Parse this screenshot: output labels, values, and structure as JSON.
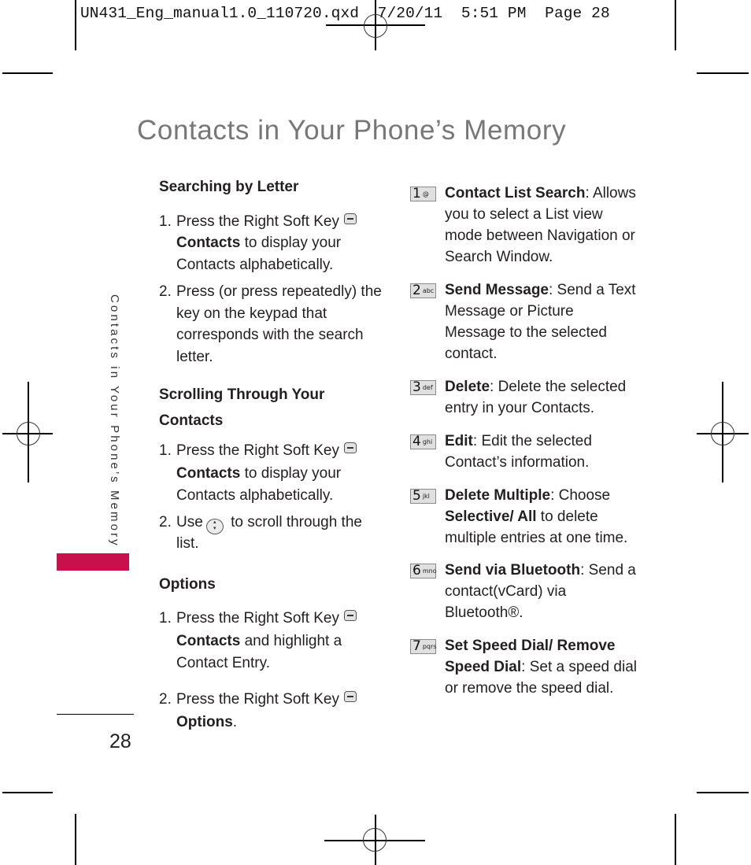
{
  "slug": {
    "filename": "UN431_Eng_manual1.0_110720.qxd",
    "date": "7/20/11",
    "time": "5:51 PM",
    "page_label": "Page 28"
  },
  "title": "Contacts in Your Phone’s Memory",
  "side_tab": {
    "text": "Contacts in Your Phone’s Memory",
    "accent_color": "#c8104c"
  },
  "page_number": "28",
  "left_column": {
    "sections": [
      {
        "heading": "Searching by Letter",
        "steps": [
          {
            "num": "1.",
            "pre": "Press the Right Soft Key",
            "icon": "right-soft-key-icon",
            "bold": "Contacts",
            "post": " to display your Contacts alphabetically."
          },
          {
            "num": "2.",
            "text": "Press (or press repeatedly) the key on the keypad that corresponds with the search letter."
          }
        ]
      },
      {
        "heading": "Scrolling Through Your Contacts",
        "steps": [
          {
            "num": "1.",
            "pre": "Press the Right Soft Key",
            "icon": "right-soft-key-icon",
            "bold": "Contacts",
            "post": " to display your Contacts alphabetically."
          },
          {
            "num": "2.",
            "pre": "Use",
            "icon": "navigation-key-icon",
            "post": " to scroll through the list."
          }
        ]
      },
      {
        "heading": "Options",
        "steps": [
          {
            "num": "1.",
            "pre": "Press the Right Soft Key",
            "icon": "right-soft-key-icon",
            "bold": "Contacts",
            "post": " and highlight a Contact Entry."
          },
          {
            "num": "2.",
            "pre": "Press the Right Soft Key",
            "icon": "right-soft-key-icon",
            "bold": "Options",
            "post": "."
          }
        ]
      }
    ]
  },
  "right_column": {
    "options": [
      {
        "key_digit": "1",
        "key_letters": "@",
        "bold": "Contact List Search",
        "text": ": Allows you to select a List view mode between Navigation or Search Window."
      },
      {
        "key_digit": "2",
        "key_letters": "abc",
        "bold": "Send Message",
        "text": ": Send a Text Message or Picture Message to the selected contact."
      },
      {
        "key_digit": "3",
        "key_letters": "def",
        "bold": "Delete",
        "text": ": Delete the selected entry in your Contacts."
      },
      {
        "key_digit": "4",
        "key_letters": "ghi",
        "bold": "Edit",
        "text": ": Edit the selected Contact’s information."
      },
      {
        "key_digit": "5",
        "key_letters": "jkl",
        "bold": "Delete Multiple",
        "text": ": Choose ",
        "bold2": "Selective/ All",
        "text2": " to delete multiple entries at one time."
      },
      {
        "key_digit": "6",
        "key_letters": "mno",
        "bold": "Send via Bluetooth",
        "text": ": Send a contact(vCard) via Bluetooth®."
      },
      {
        "key_digit": "7",
        "key_letters": "pqrs",
        "bold": "Set Speed Dial/ Remove Speed Dial",
        "text": ": Set a speed dial or remove the speed dial."
      }
    ]
  }
}
